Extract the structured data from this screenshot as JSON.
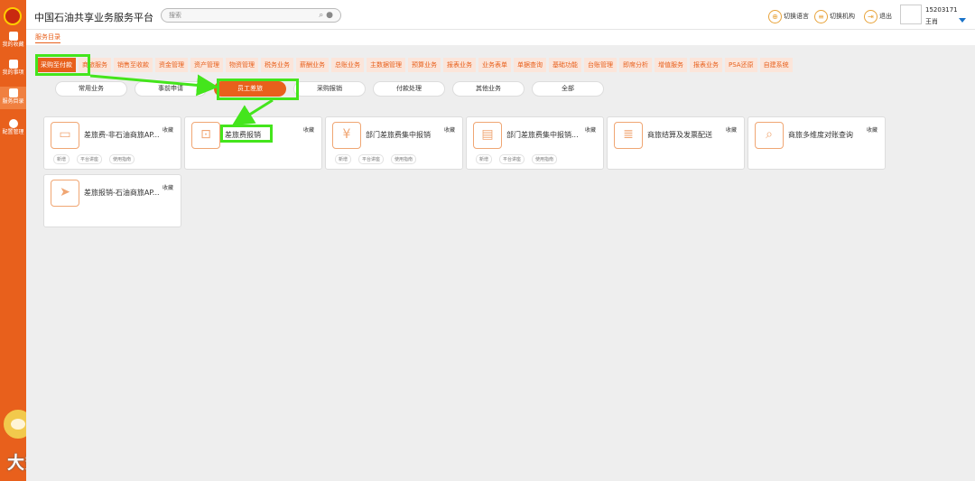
{
  "sidebar": {
    "items": [
      {
        "label": "我的收藏",
        "icon": "user-icon"
      },
      {
        "label": "我的事项",
        "icon": "document-icon"
      },
      {
        "label": "服务目录",
        "icon": "layers-icon"
      },
      {
        "label": "配置管理",
        "icon": "gear-icon"
      }
    ],
    "watermark": "大数跨境"
  },
  "header": {
    "title": "中国石油共享业务服务平台",
    "search_placeholder": "搜索",
    "switch_language": "切换语言",
    "switch_org": "切换机构",
    "logout": "退出",
    "user_id": "15203171",
    "user_name": "王肖"
  },
  "breadcrumb": "服务目录",
  "categories": [
    "采购至付款",
    "商旅服务",
    "销售至收款",
    "资金管理",
    "资产管理",
    "物资管理",
    "税务业务",
    "薪酬业务",
    "总账业务",
    "主数据管理",
    "预算业务",
    "报表业务",
    "业务表单",
    "单据查询",
    "基础功能",
    "台账管理",
    "即席分析",
    "增值服务",
    "报表业务",
    "PSA还原",
    "自建系统"
  ],
  "subcategories": [
    "常用业务",
    "事前申请",
    "员工差旅",
    "采购报销",
    "付款处理",
    "其他业务",
    "全部"
  ],
  "cards": [
    {
      "title": "差旅费-非石油商旅AP...",
      "fav": "收藏",
      "icon": "credit-card-icon",
      "actions": [
        "新增",
        "平台讲座",
        "使用指南"
      ]
    },
    {
      "title": "差旅费报销",
      "fav": "收藏",
      "icon": "luggage-icon",
      "actions": []
    },
    {
      "title": "部门差旅费集中报销",
      "fav": "收藏",
      "icon": "briefcase-yen-icon",
      "actions": [
        "新增",
        "平台讲座",
        "使用指南"
      ]
    },
    {
      "title": "部门差旅费集中报销...",
      "fav": "收藏",
      "icon": "documents-icon",
      "actions": [
        "新增",
        "平台讲座",
        "使用指南"
      ]
    },
    {
      "title": "商旅结算及发票配送",
      "fav": "收藏",
      "icon": "invoice-icon",
      "actions": []
    },
    {
      "title": "商旅多维度对账查询",
      "fav": "收藏",
      "icon": "search-doc-icon",
      "actions": []
    },
    {
      "title": "差旅报销-石油商旅AP...",
      "fav": "收藏",
      "icon": "send-icon",
      "actions": []
    }
  ]
}
